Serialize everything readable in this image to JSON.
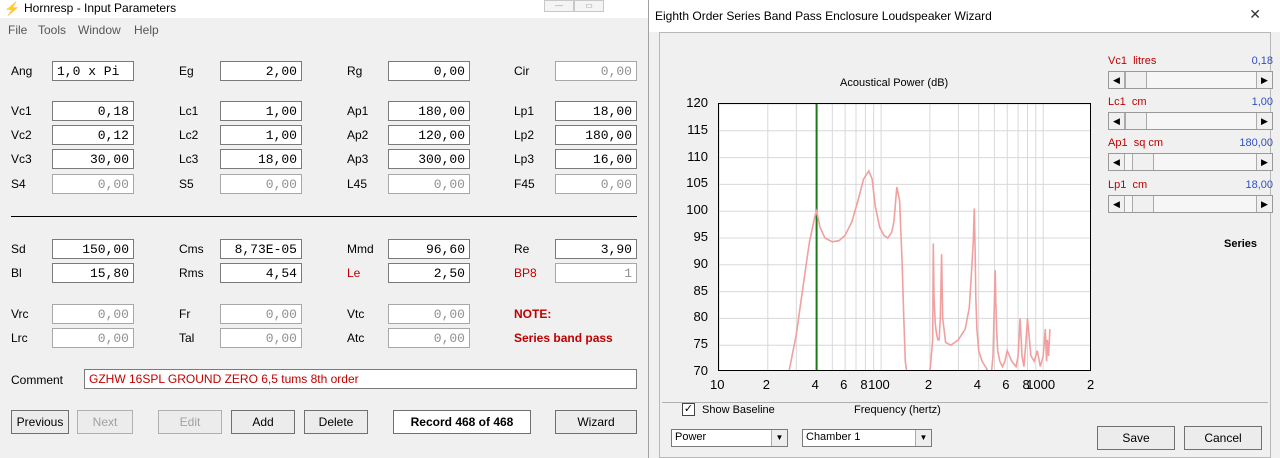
{
  "left": {
    "title": "Hornresp - Input Parameters",
    "menu": [
      "File",
      "Tools",
      "Window",
      "Help"
    ],
    "labels": {
      "Ang": "Ang",
      "Eg": "Eg",
      "Rg": "Rg",
      "Cir": "Cir",
      "Vc1": "Vc1",
      "Lc1": "Lc1",
      "Ap1": "Ap1",
      "Lp1": "Lp1",
      "Vc2": "Vc2",
      "Lc2": "Lc2",
      "Ap2": "Ap2",
      "Lp2": "Lp2",
      "Vc3": "Vc3",
      "Lc3": "Lc3",
      "Ap3": "Ap3",
      "Lp3": "Lp3",
      "S4": "S4",
      "S5": "S5",
      "L45": "L45",
      "F45": "F45",
      "Sd": "Sd",
      "Cms": "Cms",
      "Mmd": "Mmd",
      "Re": "Re",
      "Bl": "Bl",
      "Rms": "Rms",
      "Le": "Le",
      "BP8": "BP8",
      "Vrc": "Vrc",
      "Fr": "Fr",
      "Vtc": "Vtc",
      "NOTE": "NOTE:",
      "Lrc": "Lrc",
      "Tal": "Tal",
      "Atc": "Atc",
      "SBP": "Series band pass"
    },
    "values": {
      "Ang": "1,0 x Pi",
      "Eg": "2,00",
      "Rg": "0,00",
      "Cir": "0,00",
      "Vc1": "0,18",
      "Lc1": "1,00",
      "Ap1": "180,00",
      "Lp1": "18,00",
      "Vc2": "0,12",
      "Lc2": "1,00",
      "Ap2": "120,00",
      "Lp2": "180,00",
      "Vc3": "30,00",
      "Lc3": "18,00",
      "Ap3": "300,00",
      "Lp3": "16,00",
      "S4": "0,00",
      "S5": "0,00",
      "L45": "0,00",
      "F45": "0,00",
      "Sd": "150,00",
      "Cms": "8,73E-05",
      "Mmd": "96,60",
      "Re": "3,90",
      "Bl": "15,80",
      "Rms": "4,54",
      "Le": "2,50",
      "BP8": "1",
      "Vrc": "0,00",
      "Fr": "0,00",
      "Vtc": "0,00",
      "Lrc": "0,00",
      "Tal": "0,00",
      "Atc": "0,00"
    },
    "comment_label": "Comment",
    "comment": "GZHW 16SPL GROUND ZERO 6,5 tums 8th order",
    "buttons": {
      "previous": "Previous",
      "next": "Next",
      "edit": "Edit",
      "add": "Add",
      "delete": "Delete",
      "wizard": "Wizard"
    },
    "record": "Record 468 of 468"
  },
  "right": {
    "title": "Eighth Order Series Band Pass Enclosure Loudspeaker Wizard",
    "close": "✕",
    "sliders": [
      {
        "name": "Vc1",
        "unit": "litres",
        "value": "0,18",
        "position": 0.0
      },
      {
        "name": "Lc1",
        "unit": "cm",
        "value": "1,00",
        "position": 0.0
      },
      {
        "name": "Ap1",
        "unit": "sq cm",
        "value": "180,00",
        "position": 0.12
      },
      {
        "name": "Lp1",
        "unit": "cm",
        "value": "18,00",
        "position": 0.12
      }
    ],
    "series_label": "Series",
    "show_baseline": "Show Baseline",
    "show_baseline_checked": "✓",
    "select_power": "Power",
    "select_chamber": "Chamber 1",
    "save": "Save",
    "cancel": "Cancel"
  },
  "chart_data": {
    "type": "line",
    "title": "Acoustical Power (dB)",
    "xlabel": "Frequency (hertz)",
    "ylabel": "",
    "x_scale": "log",
    "xlim": [
      10,
      2000
    ],
    "ylim": [
      70,
      120
    ],
    "yticks": [
      120,
      115,
      110,
      105,
      100,
      95,
      90,
      85,
      80,
      75,
      70
    ],
    "xticks": [
      {
        "v": 10,
        "t": "10"
      },
      {
        "v": 20,
        "t": "2"
      },
      {
        "v": 40,
        "t": "4"
      },
      {
        "v": 60,
        "t": "6"
      },
      {
        "v": 80,
        "t": "8"
      },
      {
        "v": 100,
        "t": "100"
      },
      {
        "v": 200,
        "t": "2"
      },
      {
        "v": 400,
        "t": "4"
      },
      {
        "v": 600,
        "t": "6"
      },
      {
        "v": 800,
        "t": "8"
      },
      {
        "v": 1000,
        "t": "1000"
      },
      {
        "v": 2000,
        "t": "2"
      }
    ],
    "grid": true,
    "marker_x": 40,
    "series": [
      {
        "color": "#f0a0a0",
        "x": [
          27,
          30,
          33,
          36,
          39,
          40,
          42,
          45,
          50,
          55,
          60,
          66,
          72,
          78,
          84,
          88,
          92,
          98,
          104,
          110,
          116,
          120,
          125,
          130,
          135,
          138,
          141,
          144,
          147,
          150,
          160,
          170,
          180,
          190,
          200,
          208,
          210,
          212,
          216,
          220,
          224,
          228,
          232,
          236,
          240,
          250,
          270,
          300,
          330,
          350,
          360,
          370,
          376,
          380,
          384,
          390,
          400,
          420,
          440,
          460,
          480,
          490,
          500,
          506,
          510,
          516,
          524,
          540,
          560,
          580,
          600,
          640,
          680,
          700,
          720,
          740,
          760,
          780,
          800,
          840,
          880,
          920,
          960,
          1000,
          1030,
          1050,
          1060,
          1080,
          1100
        ],
        "y": [
          70,
          77,
          86,
          94,
          99,
          100,
          97,
          95,
          94.3,
          94.5,
          95.5,
          98,
          102,
          106,
          107.5,
          106,
          101,
          97,
          95.5,
          95,
          96,
          98,
          104.5,
          102,
          90,
          80,
          72,
          70,
          70,
          70,
          70,
          70,
          70,
          70,
          70,
          76,
          94,
          84,
          79,
          77,
          76,
          76,
          80,
          92,
          80,
          75.5,
          75,
          76,
          78,
          82,
          88,
          94,
          100.5,
          93,
          84,
          78,
          74,
          72,
          71,
          70,
          70,
          73,
          83,
          89,
          83,
          78,
          74,
          72,
          71,
          72,
          74,
          72,
          71,
          73,
          80,
          73,
          71,
          75,
          80,
          73,
          72,
          74,
          71,
          73,
          78,
          72,
          76,
          73,
          78
        ]
      }
    ]
  }
}
